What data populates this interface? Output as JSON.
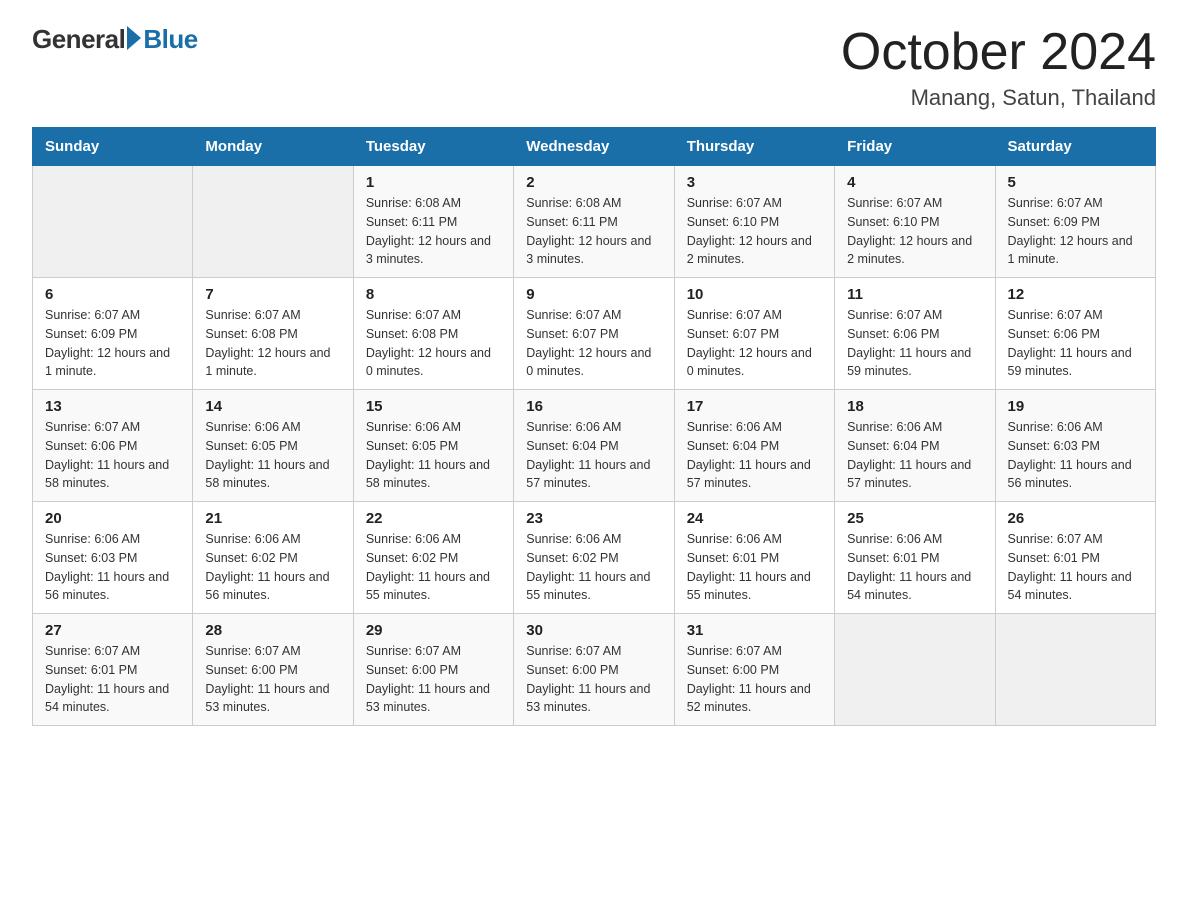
{
  "logo": {
    "general": "General",
    "blue": "Blue"
  },
  "title": "October 2024",
  "location": "Manang, Satun, Thailand",
  "weekdays": [
    "Sunday",
    "Monday",
    "Tuesday",
    "Wednesday",
    "Thursday",
    "Friday",
    "Saturday"
  ],
  "weeks": [
    [
      {
        "day": "",
        "info": ""
      },
      {
        "day": "",
        "info": ""
      },
      {
        "day": "1",
        "info": "Sunrise: 6:08 AM\nSunset: 6:11 PM\nDaylight: 12 hours\nand 3 minutes."
      },
      {
        "day": "2",
        "info": "Sunrise: 6:08 AM\nSunset: 6:11 PM\nDaylight: 12 hours\nand 3 minutes."
      },
      {
        "day": "3",
        "info": "Sunrise: 6:07 AM\nSunset: 6:10 PM\nDaylight: 12 hours\nand 2 minutes."
      },
      {
        "day": "4",
        "info": "Sunrise: 6:07 AM\nSunset: 6:10 PM\nDaylight: 12 hours\nand 2 minutes."
      },
      {
        "day": "5",
        "info": "Sunrise: 6:07 AM\nSunset: 6:09 PM\nDaylight: 12 hours\nand 1 minute."
      }
    ],
    [
      {
        "day": "6",
        "info": "Sunrise: 6:07 AM\nSunset: 6:09 PM\nDaylight: 12 hours\nand 1 minute."
      },
      {
        "day": "7",
        "info": "Sunrise: 6:07 AM\nSunset: 6:08 PM\nDaylight: 12 hours\nand 1 minute."
      },
      {
        "day": "8",
        "info": "Sunrise: 6:07 AM\nSunset: 6:08 PM\nDaylight: 12 hours\nand 0 minutes."
      },
      {
        "day": "9",
        "info": "Sunrise: 6:07 AM\nSunset: 6:07 PM\nDaylight: 12 hours\nand 0 minutes."
      },
      {
        "day": "10",
        "info": "Sunrise: 6:07 AM\nSunset: 6:07 PM\nDaylight: 12 hours\nand 0 minutes."
      },
      {
        "day": "11",
        "info": "Sunrise: 6:07 AM\nSunset: 6:06 PM\nDaylight: 11 hours\nand 59 minutes."
      },
      {
        "day": "12",
        "info": "Sunrise: 6:07 AM\nSunset: 6:06 PM\nDaylight: 11 hours\nand 59 minutes."
      }
    ],
    [
      {
        "day": "13",
        "info": "Sunrise: 6:07 AM\nSunset: 6:06 PM\nDaylight: 11 hours\nand 58 minutes."
      },
      {
        "day": "14",
        "info": "Sunrise: 6:06 AM\nSunset: 6:05 PM\nDaylight: 11 hours\nand 58 minutes."
      },
      {
        "day": "15",
        "info": "Sunrise: 6:06 AM\nSunset: 6:05 PM\nDaylight: 11 hours\nand 58 minutes."
      },
      {
        "day": "16",
        "info": "Sunrise: 6:06 AM\nSunset: 6:04 PM\nDaylight: 11 hours\nand 57 minutes."
      },
      {
        "day": "17",
        "info": "Sunrise: 6:06 AM\nSunset: 6:04 PM\nDaylight: 11 hours\nand 57 minutes."
      },
      {
        "day": "18",
        "info": "Sunrise: 6:06 AM\nSunset: 6:04 PM\nDaylight: 11 hours\nand 57 minutes."
      },
      {
        "day": "19",
        "info": "Sunrise: 6:06 AM\nSunset: 6:03 PM\nDaylight: 11 hours\nand 56 minutes."
      }
    ],
    [
      {
        "day": "20",
        "info": "Sunrise: 6:06 AM\nSunset: 6:03 PM\nDaylight: 11 hours\nand 56 minutes."
      },
      {
        "day": "21",
        "info": "Sunrise: 6:06 AM\nSunset: 6:02 PM\nDaylight: 11 hours\nand 56 minutes."
      },
      {
        "day": "22",
        "info": "Sunrise: 6:06 AM\nSunset: 6:02 PM\nDaylight: 11 hours\nand 55 minutes."
      },
      {
        "day": "23",
        "info": "Sunrise: 6:06 AM\nSunset: 6:02 PM\nDaylight: 11 hours\nand 55 minutes."
      },
      {
        "day": "24",
        "info": "Sunrise: 6:06 AM\nSunset: 6:01 PM\nDaylight: 11 hours\nand 55 minutes."
      },
      {
        "day": "25",
        "info": "Sunrise: 6:06 AM\nSunset: 6:01 PM\nDaylight: 11 hours\nand 54 minutes."
      },
      {
        "day": "26",
        "info": "Sunrise: 6:07 AM\nSunset: 6:01 PM\nDaylight: 11 hours\nand 54 minutes."
      }
    ],
    [
      {
        "day": "27",
        "info": "Sunrise: 6:07 AM\nSunset: 6:01 PM\nDaylight: 11 hours\nand 54 minutes."
      },
      {
        "day": "28",
        "info": "Sunrise: 6:07 AM\nSunset: 6:00 PM\nDaylight: 11 hours\nand 53 minutes."
      },
      {
        "day": "29",
        "info": "Sunrise: 6:07 AM\nSunset: 6:00 PM\nDaylight: 11 hours\nand 53 minutes."
      },
      {
        "day": "30",
        "info": "Sunrise: 6:07 AM\nSunset: 6:00 PM\nDaylight: 11 hours\nand 53 minutes."
      },
      {
        "day": "31",
        "info": "Sunrise: 6:07 AM\nSunset: 6:00 PM\nDaylight: 11 hours\nand 52 minutes."
      },
      {
        "day": "",
        "info": ""
      },
      {
        "day": "",
        "info": ""
      }
    ]
  ]
}
